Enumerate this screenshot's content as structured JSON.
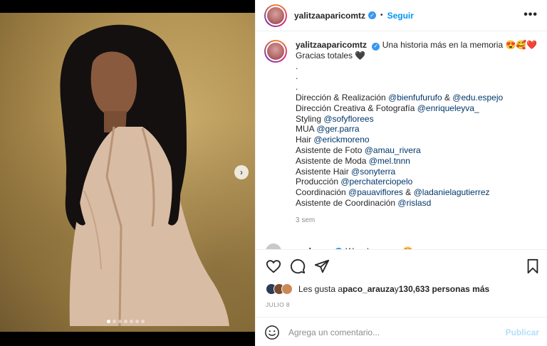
{
  "header": {
    "username": "yalitzaaparicomtz",
    "separator": "•",
    "follow_label": "Seguir",
    "more_icon": "•••"
  },
  "media": {
    "next_icon": "›",
    "dots_count": 7,
    "active_dot": 0
  },
  "caption": {
    "username": "yalitzaaparicomtz",
    "intro": "Una historia más en la memoria 😍🥰❤️",
    "line2": "Gracias totales 🖤",
    "dot1": ".",
    "dot2": ".",
    "dot3": ".",
    "credits": [
      {
        "label": "Dirección & Realización ",
        "m1": "@bienfufurufo",
        "mid": " & ",
        "m2": "@edu.espejo"
      },
      {
        "label": "Dirección Creativa & Fotografía ",
        "m1": "@enriqueleyva_",
        "mid": "",
        "m2": ""
      },
      {
        "label": "Styling ",
        "m1": "@sofyflorees",
        "mid": "",
        "m2": ""
      },
      {
        "label": "MUA ",
        "m1": "@ger.parra",
        "mid": "",
        "m2": ""
      },
      {
        "label": "Hair ",
        "m1": "@erickmoreno",
        "mid": "",
        "m2": ""
      },
      {
        "label": "Asistente de Foto ",
        "m1": "@amau_rivera",
        "mid": "",
        "m2": ""
      },
      {
        "label": "Asistente de Moda ",
        "m1": "@mel.tnnn",
        "mid": "",
        "m2": ""
      },
      {
        "label": "Asistente Hair ",
        "m1": "@sonyterra",
        "mid": "",
        "m2": ""
      },
      {
        "label": "Producción ",
        "m1": "@perchaterciopelo",
        "mid": "",
        "m2": ""
      },
      {
        "label": "Coordinación ",
        "m1": "@pauaviflores",
        "mid": " & ",
        "m2": "@ladanielagutierrez"
      },
      {
        "label": "Asistente de Coordinación ",
        "m1": "@rislasd",
        "mid": "",
        "m2": ""
      }
    ],
    "time": "3 sem"
  },
  "comment_peek": {
    "username": "anahrosa",
    "text": "Wow hermosa 😍"
  },
  "likes": {
    "prefix": "Les gusta a ",
    "user": "paco_arauza",
    "mid": " y ",
    "count": "130,633 personas más",
    "avatar_colors": [
      "#2b3a55",
      "#7a4a2e",
      "#c98a5a"
    ]
  },
  "date": "JULIO 8",
  "add_comment": {
    "placeholder": "Agrega un comentario...",
    "publish_label": "Publicar"
  },
  "colors": {
    "accent": "#0095f6",
    "verified": "#3897f0",
    "mention": "#00376b",
    "muted": "#8e8e8e"
  },
  "icons": [
    "more-options-icon",
    "verified-icon",
    "next-arrow-icon",
    "heart-icon",
    "comment-icon",
    "share-icon",
    "bookmark-icon",
    "emoji-icon"
  ]
}
